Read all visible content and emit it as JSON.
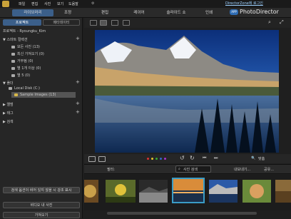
{
  "menubar": {
    "items": [
      "파일",
      "편집",
      "사진",
      "보기",
      "도움말"
    ],
    "login": "DirectorZone에 로그인"
  },
  "tabs": {
    "library": "라이브러리",
    "adjust": "조정",
    "edit": "편집",
    "layers": "레이어",
    "slideshow": "슬라이드 쇼",
    "print": "인쇄"
  },
  "brand": {
    "badge": "APP",
    "name": "PhotoDirector"
  },
  "sidebar": {
    "project_tab": "프로젝트",
    "metadata_tab": "메타데이터",
    "project_name": "프로젝트 - Ryoungku_Kim",
    "smart_collection": "스마트 컬렉션",
    "smart_items": [
      "모든 사진 (13)",
      "최신 가져오기 (0)",
      "거부됨 (0)",
      "별 1개 이상 (0)",
      "별 5 (0)"
    ],
    "folders": "폴더",
    "disk": "Local Disk (C:)",
    "sample_folder": "Sample Images (13)",
    "albums": "앨범",
    "tags": "태그",
    "history": "검색",
    "btn_find": "검색 옵션이 비어 있지 않을 시 강조 표시",
    "btn_import": "비디오 내 사진",
    "btn_bring": "가져오기"
  },
  "filterbar": {
    "filter": "필터:",
    "search": "사진 검색",
    "export": "내보내기...",
    "share": "공유..."
  },
  "zoom": "맞춤",
  "colors": {
    "accent": "#3b5f8a",
    "label_red": "#d33",
    "label_yellow": "#e6c32c",
    "label_green": "#3a3",
    "label_blue": "#36c",
    "label_purple": "#a3c"
  }
}
